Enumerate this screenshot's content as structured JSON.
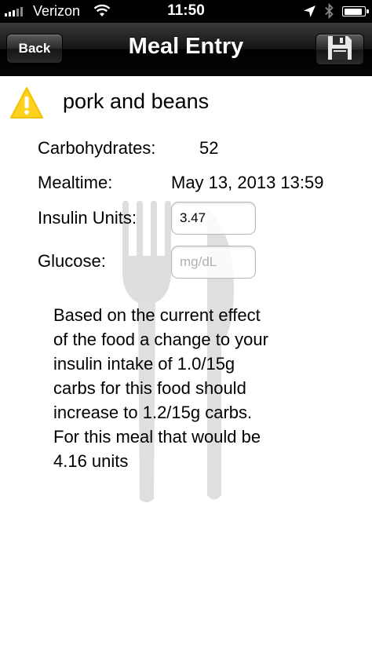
{
  "status_bar": {
    "carrier": "Verizon",
    "time": "11:50",
    "signal_icon": "signal-bars-icon",
    "wifi_icon": "wifi-icon",
    "location_icon": "location-arrow-icon",
    "bluetooth_icon": "bluetooth-icon",
    "battery_icon": "battery-icon",
    "signal_strength_bars": 3,
    "signal_total_bars": 5,
    "battery_level": 0.9
  },
  "nav": {
    "title": "Meal Entry",
    "back_label": "Back",
    "save_icon": "floppy-disk-icon"
  },
  "meal": {
    "name": "pork and beans",
    "warning_icon": "warning-triangle-icon",
    "warning_color": "#FFD21F"
  },
  "fields": {
    "carbohydrates_label": "Carbohydrates:",
    "carbohydrates_value": "52",
    "mealtime_label": "Mealtime:",
    "mealtime_value": "May 13, 2013 13:59",
    "insulin_label": "Insulin Units:",
    "insulin_value": "3.47",
    "glucose_label": "Glucose:",
    "glucose_placeholder": "mg/dL",
    "glucose_value": ""
  },
  "advice": "Based on the current effect\nof the food a change to your\ninsulin intake of 1.0/15g\ncarbs for this food should\nincrease to 1.2/15g carbs.\nFor this meal that would be\n4.16 units",
  "background": {
    "utensils_icon": "fork-and-knife-icon"
  }
}
